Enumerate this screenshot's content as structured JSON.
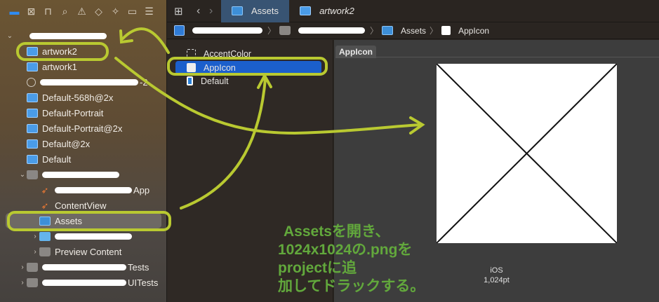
{
  "toolbar": {
    "icons": [
      "folder-icon",
      "source-control-icon",
      "hierarchy-icon",
      "search-icon",
      "warning-icon",
      "test-icon",
      "debug-icon",
      "breakpoint-icon",
      "report-icon"
    ]
  },
  "navigator": {
    "rows": [
      {
        "label": "",
        "redacted": true,
        "icon": "project",
        "chev": "down",
        "indent": 0
      },
      {
        "label": "artwork2",
        "icon": "img",
        "indent": 1
      },
      {
        "label": "artwork1",
        "icon": "img",
        "indent": 1
      },
      {
        "label": "-2",
        "redacted": true,
        "icon": "gear",
        "indent": 1
      },
      {
        "label": "Default-568h@2x",
        "icon": "img",
        "indent": 1
      },
      {
        "label": "Default-Portrait",
        "icon": "img",
        "indent": 1
      },
      {
        "label": "Default-Portrait@2x",
        "icon": "img",
        "indent": 1
      },
      {
        "label": "Default@2x",
        "icon": "img",
        "indent": 1
      },
      {
        "label": "Default",
        "icon": "img",
        "indent": 1
      },
      {
        "label": "",
        "redacted": true,
        "icon": "folder",
        "chev": "down",
        "indent": 1
      },
      {
        "label": "App",
        "redacted": true,
        "icon": "swift",
        "indent": 2
      },
      {
        "label": "ContentView",
        "icon": "swift",
        "indent": 2
      },
      {
        "label": "Assets",
        "icon": "assets",
        "indent": 2,
        "selected": true
      },
      {
        "label": "",
        "redacted": true,
        "icon": "bfolder",
        "chev": "right",
        "indent": 2
      },
      {
        "label": "Preview Content",
        "icon": "folder",
        "chev": "right",
        "indent": 2
      },
      {
        "label": "Tests",
        "redacted": true,
        "icon": "folder",
        "chev": "right",
        "indent": 1
      },
      {
        "label": "UITests",
        "redacted": true,
        "icon": "folder",
        "chev": "right",
        "indent": 1
      }
    ]
  },
  "tabs": [
    {
      "label": "Assets",
      "active": true
    },
    {
      "label": "artwork2",
      "active": false
    }
  ],
  "breadcrumb": {
    "items": [
      "Assets",
      "AppIcon"
    ]
  },
  "asset_list": [
    {
      "label": "AccentColor"
    },
    {
      "label": "AppIcon",
      "selected": true
    },
    {
      "label": "Default"
    }
  ],
  "detail": {
    "header": "AppIcon",
    "platform": "iOS",
    "size": "1,024pt"
  },
  "annotation": {
    "lines": [
      "Assetsを開き、",
      "1024x1024の.pngを",
      "projectに追",
      "加してドラックする。"
    ],
    "color": "#62a83c",
    "mark_color": "#b9c931"
  }
}
